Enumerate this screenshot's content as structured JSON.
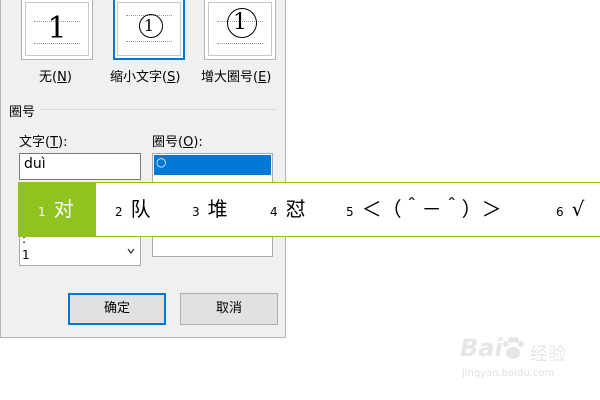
{
  "dialog": {
    "style_options": [
      {
        "sample": "1",
        "label_pre": "无(",
        "label_key": "N",
        "label_post": ")"
      },
      {
        "sample": "1",
        "label_pre": "缩小文字(",
        "label_key": "S",
        "label_post": ")"
      },
      {
        "sample": "1",
        "label_pre": "增大圈号(",
        "label_key": "E",
        "label_post": ")"
      }
    ],
    "selected_style": "缩小文字(S)",
    "group_label": "圈号",
    "text_field": {
      "label_pre": "文字(",
      "label_key": "T",
      "label_post": "):",
      "value": "duì"
    },
    "text_list_items": [
      ":",
      "1"
    ],
    "circle_field": {
      "label_pre": "圈号(",
      "label_key": "O",
      "label_post": "):",
      "selected": "○"
    },
    "ok_label": "确定",
    "cancel_label": "取消"
  },
  "ime": {
    "candidates": [
      {
        "num": "1",
        "text": "对"
      },
      {
        "num": "2",
        "text": "队"
      },
      {
        "num": "3",
        "text": "堆"
      },
      {
        "num": "4",
        "text": "怼"
      },
      {
        "num": "5",
        "text": "＜（＾－＾）＞"
      },
      {
        "num": "6",
        "text": "√"
      }
    ],
    "active_index": 0,
    "accent_color": "#8fc31f"
  },
  "watermark": {
    "brand": "Bai",
    "sub": "经验",
    "url": "jingyan.baidu.com"
  }
}
